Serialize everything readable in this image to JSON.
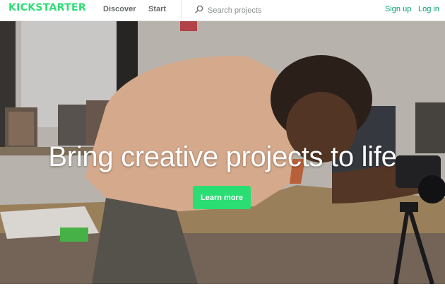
{
  "header": {
    "logo_text": "KICKSTARTER",
    "nav": {
      "discover": "Discover",
      "start": "Start"
    },
    "search": {
      "placeholder": "Search projects",
      "icon": "search-icon"
    },
    "auth": {
      "signup": "Sign up",
      "login": "Log in"
    }
  },
  "hero": {
    "title": "Bring creative projects to life",
    "cta_label": "Learn more"
  },
  "colors": {
    "brand_green": "#2bde73",
    "link_teal": "#009e74",
    "nav_gray": "#656969"
  }
}
